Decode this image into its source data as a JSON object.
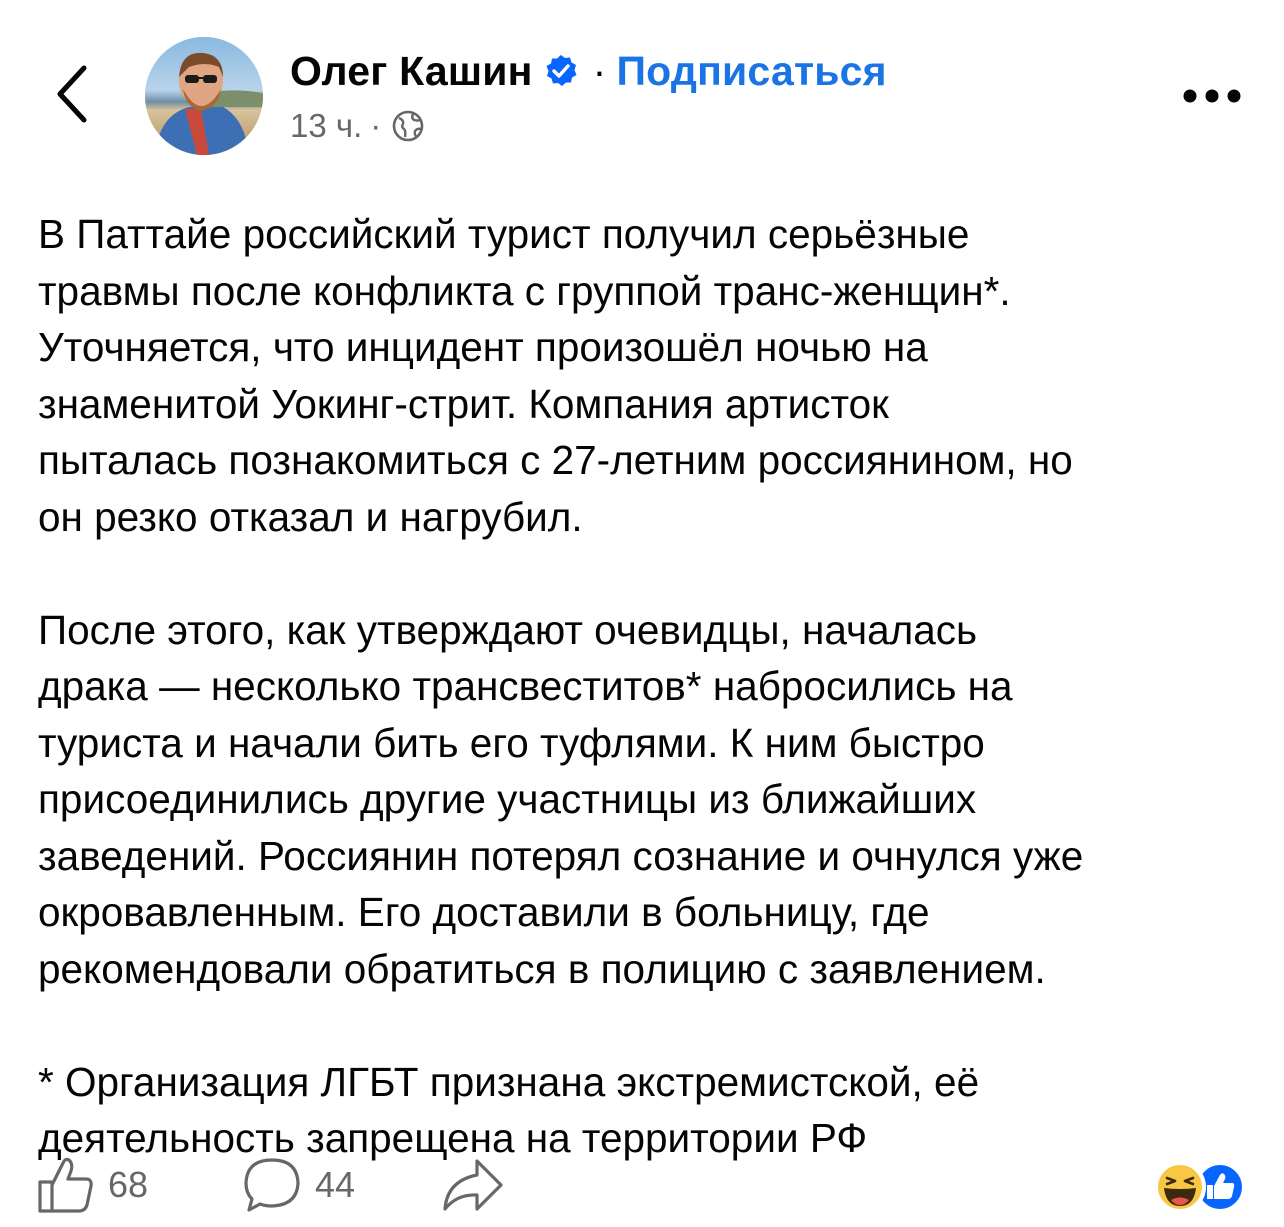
{
  "header": {
    "author_name": "Олег Кашин",
    "separator": "·",
    "subscribe_label": "Подписаться",
    "timestamp": "13 ч.",
    "meta_separator": "·"
  },
  "post": {
    "paragraphs": [
      "В Паттайе российский турист получил серьёзные\nтравмы после конфликта с группой транс-женщин*.\nУточняется, что инцидент произошёл ночью на\nзнаменитой Уокинг-стрит. Компания артисток\nпыталась познакомиться с 27-летним россиянином, но\nон резко отказал и нагрубил.",
      "После этого, как утверждают очевидцы, началась\nдрака — несколько трансвеститов* набросились на\nтуриста и начали бить его туфлями. К ним быстро\nприсоединились другие участницы из ближайших\nзаведений. Россиянин потерял сознание и очнулся уже\nокровавленным. Его доставили в больницу, где\nрекомендовали обратиться в полицию с заявлением.",
      "* Организация ЛГБТ признана экстремистской, её\nдеятельность запрещена на территории РФ"
    ]
  },
  "actions": {
    "likes": "68",
    "comments": "44"
  },
  "icons": {
    "back": "chevron-left-icon",
    "verified": "verified-badge-icon",
    "audience": "globe-icon",
    "more": "more-horizontal-icon",
    "like": "thumbs-up-icon",
    "comment": "comment-bubble-icon",
    "share": "share-arrow-icon",
    "reaction_haha": "haha-reaction-icon",
    "reaction_like": "like-reaction-icon"
  },
  "colors": {
    "link_blue": "#1b74e4",
    "verified_blue": "#0866ff",
    "secondary_text": "#65676b",
    "primary_text": "#050505"
  }
}
